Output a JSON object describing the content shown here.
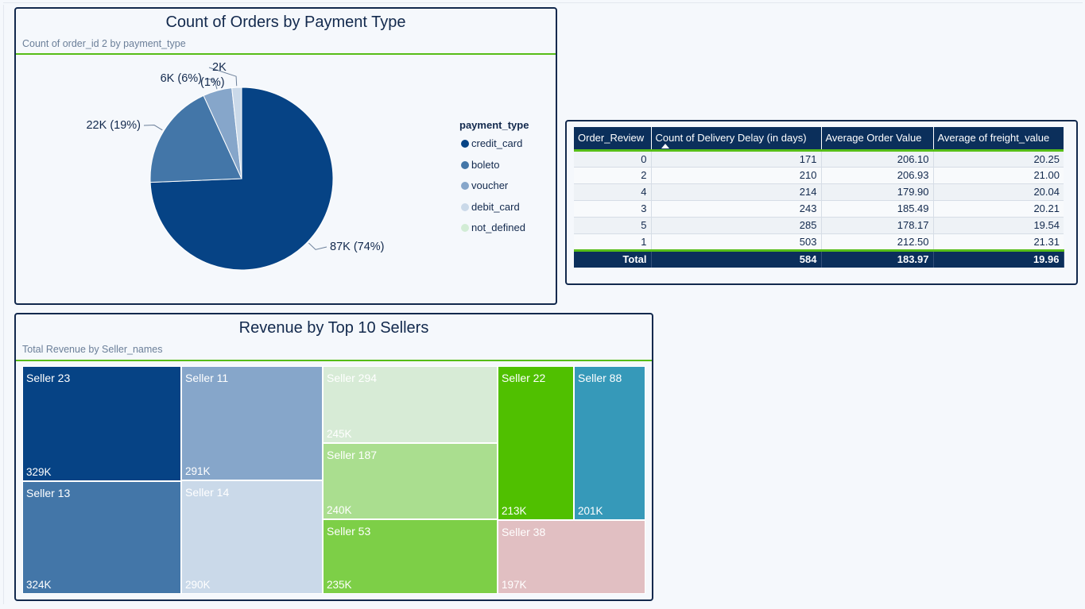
{
  "pie": {
    "title": "Count of Orders by Payment Type",
    "subtitle": "Count of order_id 2 by payment_type",
    "legend_title": "payment_type"
  },
  "table": {
    "columns": [
      "Order_Review",
      "Count of Delivery Delay (in days)",
      "Average Order Value",
      "Average of freight_value"
    ],
    "sorted_column_icon": "sort-ascending-icon",
    "rows": [
      [
        "0",
        "171",
        "206.10",
        "20.25"
      ],
      [
        "2",
        "210",
        "206.93",
        "21.00"
      ],
      [
        "4",
        "214",
        "179.90",
        "20.04"
      ],
      [
        "3",
        "243",
        "185.49",
        "20.21"
      ],
      [
        "5",
        "285",
        "178.17",
        "19.54"
      ],
      [
        "1",
        "503",
        "212.50",
        "21.31"
      ]
    ],
    "total": [
      "Total",
      "584",
      "183.97",
      "19.96"
    ]
  },
  "treemap": {
    "title": "Revenue by Top 10 Sellers",
    "subtitle": "Total Revenue by Seller_names"
  },
  "colors": {
    "navy": "#12294d",
    "accent_green": "#57bd18"
  },
  "chart_data": [
    {
      "type": "pie",
      "title": "Count of Orders by Payment Type",
      "subtitle": "Count of order_id 2 by payment_type",
      "legend_title": "payment_type",
      "legend_position": "right",
      "categories": [
        "credit_card",
        "boleto",
        "voucher",
        "debit_card",
        "not_defined"
      ],
      "values": [
        87000,
        22000,
        6000,
        2000,
        0
      ],
      "data_labels": [
        "87K (74%)",
        "22K (19%)",
        "6K (6%)",
        "2K (1%)",
        ""
      ],
      "colors": [
        "#064385",
        "#4376a8",
        "#86a6ca",
        "#cad9e9",
        "#d2ecd5"
      ]
    },
    {
      "type": "table",
      "columns": [
        "Order_Review",
        "Count of Delivery Delay (in days)",
        "Average Order Value",
        "Average of freight_value"
      ],
      "rows": [
        [
          0,
          171,
          206.1,
          20.25
        ],
        [
          2,
          210,
          206.93,
          21.0
        ],
        [
          4,
          214,
          179.9,
          20.04
        ],
        [
          3,
          243,
          185.49,
          20.21
        ],
        [
          5,
          285,
          178.17,
          19.54
        ],
        [
          1,
          503,
          212.5,
          21.31
        ]
      ],
      "total": [
        "Total",
        584,
        183.97,
        19.96
      ]
    },
    {
      "type": "treemap",
      "title": "Revenue by Top 10 Sellers",
      "subtitle": "Total Revenue by Seller_names",
      "items": [
        {
          "name": "Seller 23",
          "value": 329000,
          "label": "329K",
          "color": "#064385",
          "text": "#ffffff"
        },
        {
          "name": "Seller 13",
          "value": 324000,
          "label": "324K",
          "color": "#4376a8",
          "text": "#ffffff"
        },
        {
          "name": "Seller 11",
          "value": 291000,
          "label": "291K",
          "color": "#86a6ca",
          "text": "#ffffff"
        },
        {
          "name": "Seller 14",
          "value": 290000,
          "label": "290K",
          "color": "#cad9e9",
          "text": "#ffffff"
        },
        {
          "name": "Seller 294",
          "value": 245000,
          "label": "245K",
          "color": "#d7ebd6",
          "text": "#ffffff"
        },
        {
          "name": "Seller 187",
          "value": 240000,
          "label": "240K",
          "color": "#aade8f",
          "text": "#ffffff"
        },
        {
          "name": "Seller 53",
          "value": 235000,
          "label": "235K",
          "color": "#7dcf47",
          "text": "#ffffff"
        },
        {
          "name": "Seller 22",
          "value": 213000,
          "label": "213K",
          "color": "#50c000",
          "text": "#ffffff"
        },
        {
          "name": "Seller 88",
          "value": 201000,
          "label": "201K",
          "color": "#3699b9",
          "text": "#ffffff"
        },
        {
          "name": "Seller 38",
          "value": 197000,
          "label": "197K",
          "color": "#e1bfc2",
          "text": "#ffffff"
        }
      ]
    }
  ]
}
